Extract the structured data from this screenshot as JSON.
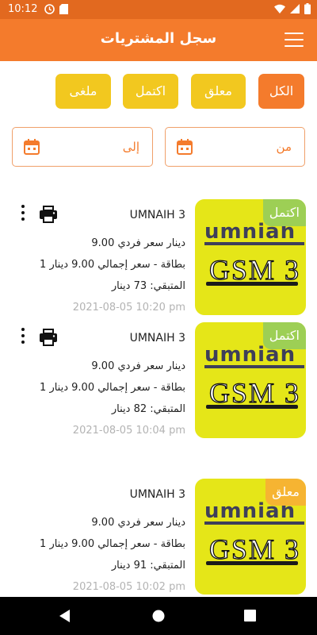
{
  "status_bar": {
    "time": "10:12"
  },
  "header": {
    "title": "سجل المشتريات"
  },
  "filters": [
    {
      "label": "الكل",
      "active": true
    },
    {
      "label": "معلق",
      "active": false
    },
    {
      "label": "اكتمل",
      "active": false
    },
    {
      "label": "ملغى",
      "active": false
    }
  ],
  "date_range": {
    "from_label": "من",
    "to_label": "إلى"
  },
  "colors": {
    "primary": "#f47b2c",
    "chip_yellow": "#f2c81f",
    "status_done": "#9dcf55",
    "status_pending": "#f6b432"
  },
  "purchases": [
    {
      "thumb_brand": "umniah",
      "thumb_text": "GSM 3",
      "status": "اكتمل",
      "name": "UMNAIH 3",
      "unit_price": "9.00 دينار سعر فردي",
      "qty_total": "1 بطاقة - سعر إجمالي 9.00 دينار",
      "remaining": "المتبقي: 73 دينار",
      "date": "2021-08-05 10:20 pm"
    },
    {
      "thumb_brand": "umniah",
      "thumb_text": "GSM 3",
      "status": "اكتمل",
      "name": "UMNAIH 3",
      "unit_price": "9.00 دينار سعر فردي",
      "qty_total": "1 بطاقة - سعر إجمالي 9.00 دينار",
      "remaining": "المتبقي: 82 دينار",
      "date": "2021-08-05 10:04 pm"
    },
    {
      "thumb_brand": "umniah",
      "thumb_text": "GSM 3",
      "status": "معلق",
      "name": "UMNAIH 3",
      "unit_price": "9.00 دينار سعر فردي",
      "qty_total": "1 بطاقة - سعر إجمالي 9.00 دينار",
      "remaining": "المتبقي: 91 دينار",
      "date": "2021-08-05 10:02 pm"
    }
  ]
}
